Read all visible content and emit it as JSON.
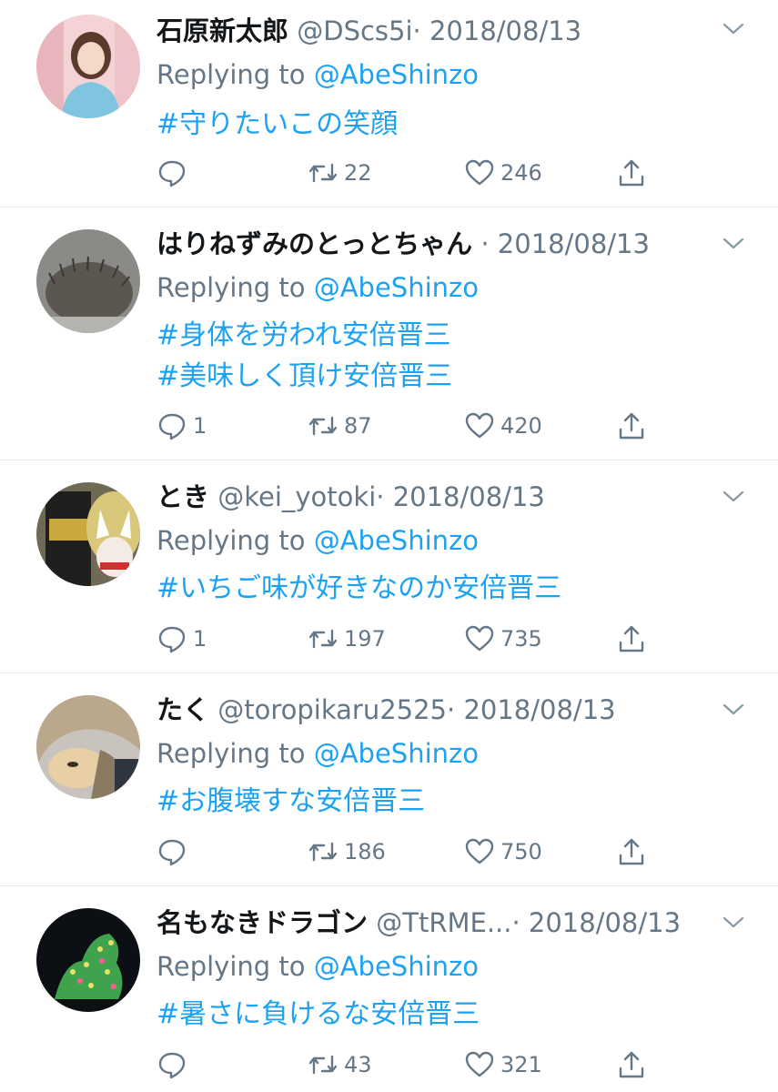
{
  "reply_prefix": "Replying to",
  "colors": {
    "link": "#1da1f2",
    "muted": "#657786",
    "text": "#14171a",
    "divider": "#e1e8ed"
  },
  "icons": {
    "reply": "comment-bubble-icon",
    "retweet": "retweet-icon",
    "like": "heart-icon",
    "share": "share-icon",
    "menu": "chevron-down-icon"
  },
  "tweets": [
    {
      "name": "石原新太郎",
      "handle": "@DScs5i",
      "sep": "·",
      "date": "2018/08/13",
      "reply_to": "@AbeShinzo",
      "lines": [
        "#守りたいこの笑顔"
      ],
      "replies": "",
      "retweets": "22",
      "likes": "246"
    },
    {
      "name": "はりねずみのとっとちゃん",
      "handle": "",
      "sep": "·",
      "date": "2018/08/13",
      "reply_to": "@AbeShinzo",
      "lines": [
        "#身体を労われ安倍晋三",
        "#美味しく頂け安倍晋三"
      ],
      "replies": "1",
      "retweets": "87",
      "likes": "420"
    },
    {
      "name": "とき",
      "handle": "@kei_yotoki",
      "sep": "·",
      "date": "2018/08/13",
      "reply_to": "@AbeShinzo",
      "lines": [
        "#いちご味が好きなのか安倍晋三"
      ],
      "replies": "1",
      "retweets": "197",
      "likes": "735"
    },
    {
      "name": "たく",
      "handle": "@toropikaru2525",
      "sep": "·",
      "date": "2018/08/13",
      "reply_to": "@AbeShinzo",
      "lines": [
        "#お腹壊すな安倍晋三"
      ],
      "replies": "",
      "retweets": "186",
      "likes": "750"
    },
    {
      "name": "名もなきドラゴン",
      "handle": "@TtRME...",
      "sep": "·",
      "date": "2018/08/13",
      "reply_to": "@AbeShinzo",
      "lines": [
        "#暑さに負けるな安倍晋三"
      ],
      "replies": "",
      "retweets": "43",
      "likes": "321"
    }
  ]
}
